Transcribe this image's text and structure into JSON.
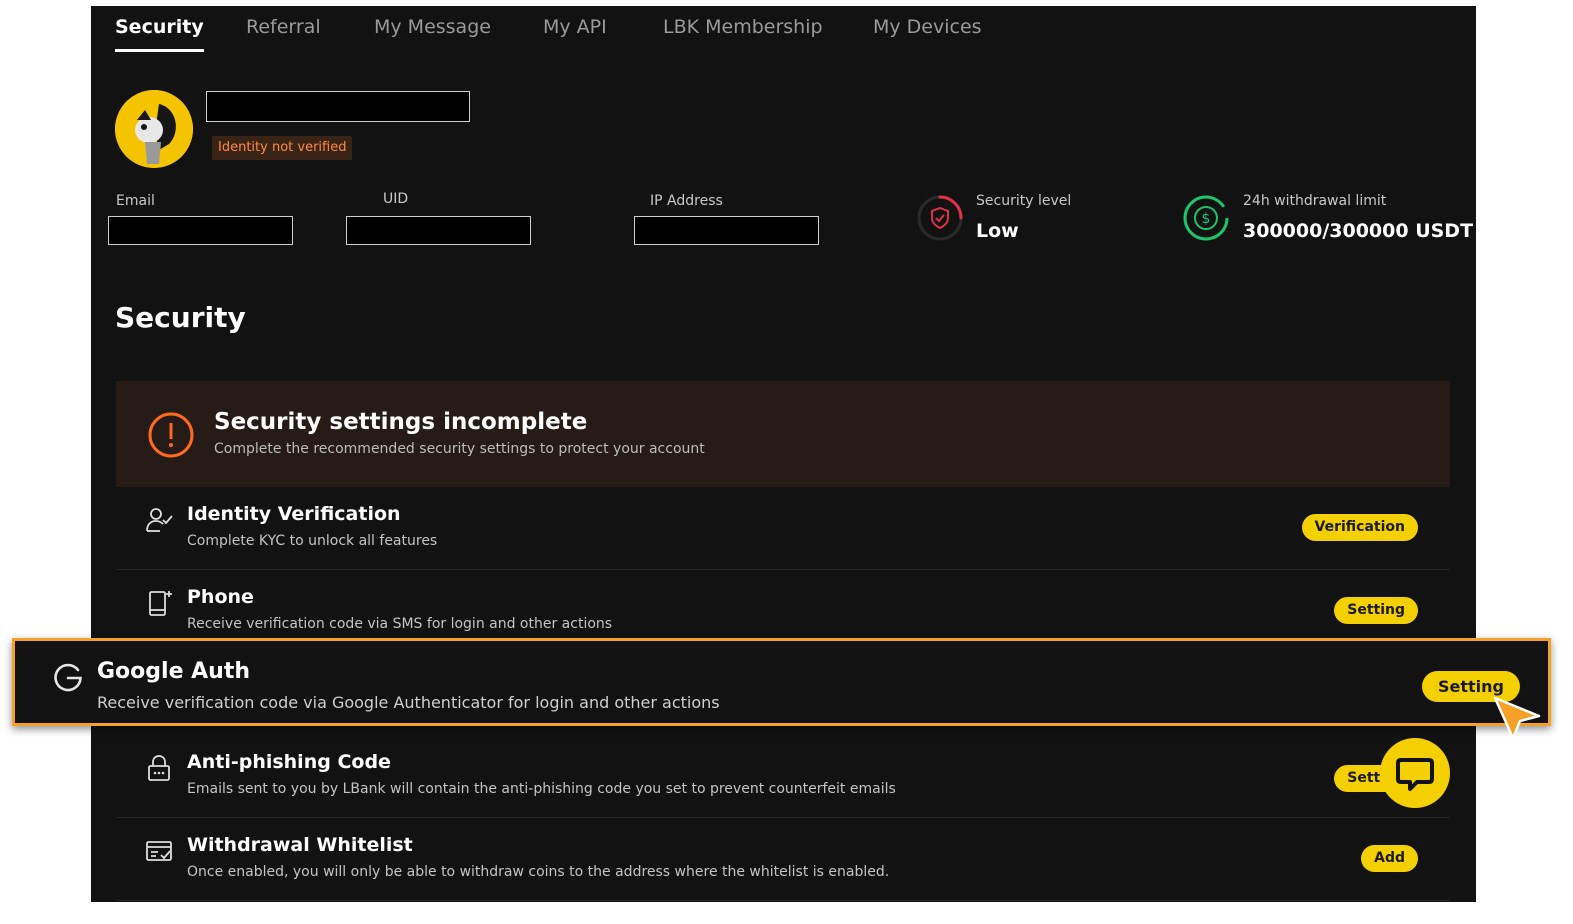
{
  "tabs": [
    {
      "label": "Security",
      "active": true
    },
    {
      "label": "Referral"
    },
    {
      "label": "My Message"
    },
    {
      "label": "My API"
    },
    {
      "label": "LBK Membership"
    },
    {
      "label": "My Devices"
    }
  ],
  "profile": {
    "verification_status": "Identity not verified",
    "fields": [
      {
        "label": "Email"
      },
      {
        "label": "UID"
      },
      {
        "label": "IP Address"
      }
    ],
    "security_level": {
      "label": "Security level",
      "value": "Low"
    },
    "withdrawal_limit": {
      "label": "24h withdrawal limit",
      "value": "300000/300000 USDT"
    }
  },
  "security": {
    "title": "Security",
    "banner": {
      "title": "Security settings incomplete",
      "subtitle": "Complete the recommended security settings to protect your account"
    },
    "items": [
      {
        "title": "Identity Verification",
        "desc": "Complete KYC to unlock all features",
        "action": "Verification",
        "icon": "user-check-icon"
      },
      {
        "title": "Phone",
        "desc": "Receive verification code via SMS for login and other actions",
        "action": "Setting",
        "icon": "phone-icon"
      },
      {
        "title": "Google Auth",
        "desc": "Receive verification code via Google Authenticator for login and other actions",
        "action": "Setting",
        "icon": "google-icon"
      },
      {
        "title": "Anti-phishing Code",
        "desc": "Emails sent to you by LBank will contain the anti-phishing code you set to prevent counterfeit emails",
        "action": "Setting",
        "icon": "lock-icon"
      },
      {
        "title": "Withdrawal Whitelist",
        "desc": "Once enabled, you will only be able to withdraw coins to the address where the whitelist is enabled.",
        "action": "Add",
        "icon": "whitelist-icon"
      }
    ]
  },
  "colors": {
    "accent": "#f5d000",
    "highlight_border": "#f7a026",
    "warning": "#ff6a1f",
    "security_low": "#e0304a",
    "limit_ring": "#1ec46a"
  }
}
